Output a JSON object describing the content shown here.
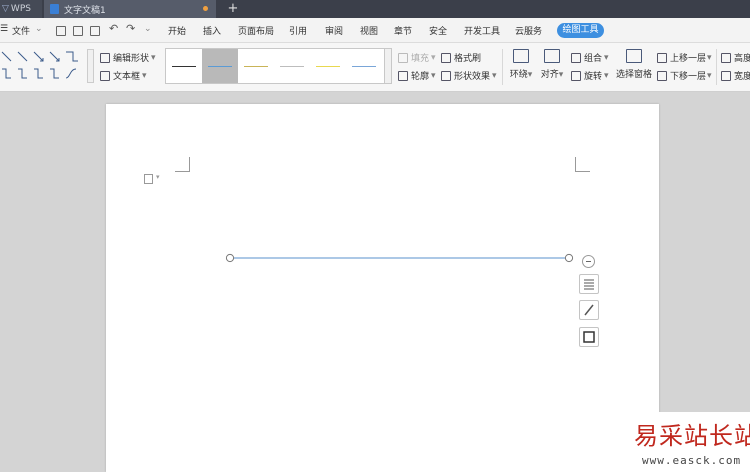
{
  "titlebar": {
    "app_tab": "WPS",
    "doc_tab": "文字文稿1",
    "new_tab": "+"
  },
  "menubar": {
    "file_label": "文件",
    "tabs": [
      "开始",
      "插入",
      "页面布局",
      "引用",
      "审阅",
      "视图",
      "章节",
      "安全",
      "开发工具",
      "云服务"
    ],
    "active_tab": "绘图工具"
  },
  "ribbon": {
    "edit_shape": "编辑形状",
    "text_box": "文本框",
    "fill": "填充",
    "format_painter": "格式刷",
    "outline": "轮廓",
    "shape_effects": "形状效果",
    "wrap": "环绕",
    "align": "对齐",
    "group": "组合",
    "rotate": "旋转",
    "selection_pane": "选择窗格",
    "bring_forward": "上移一层",
    "send_backward": "下移一层",
    "height": "高度",
    "width": "宽度"
  },
  "line_styles": [
    {
      "color": "#333333",
      "selected": false
    },
    {
      "color": "#5b9bd5",
      "selected": true
    },
    {
      "color": "#c9b458",
      "selected": false
    },
    {
      "color": "#bdbdbd",
      "selected": false
    },
    {
      "color": "#e8d850",
      "selected": false
    },
    {
      "color": "#7aa6d8",
      "selected": false
    }
  ],
  "watermark": {
    "title": "易采站长站",
    "url": "www.easck.com"
  }
}
